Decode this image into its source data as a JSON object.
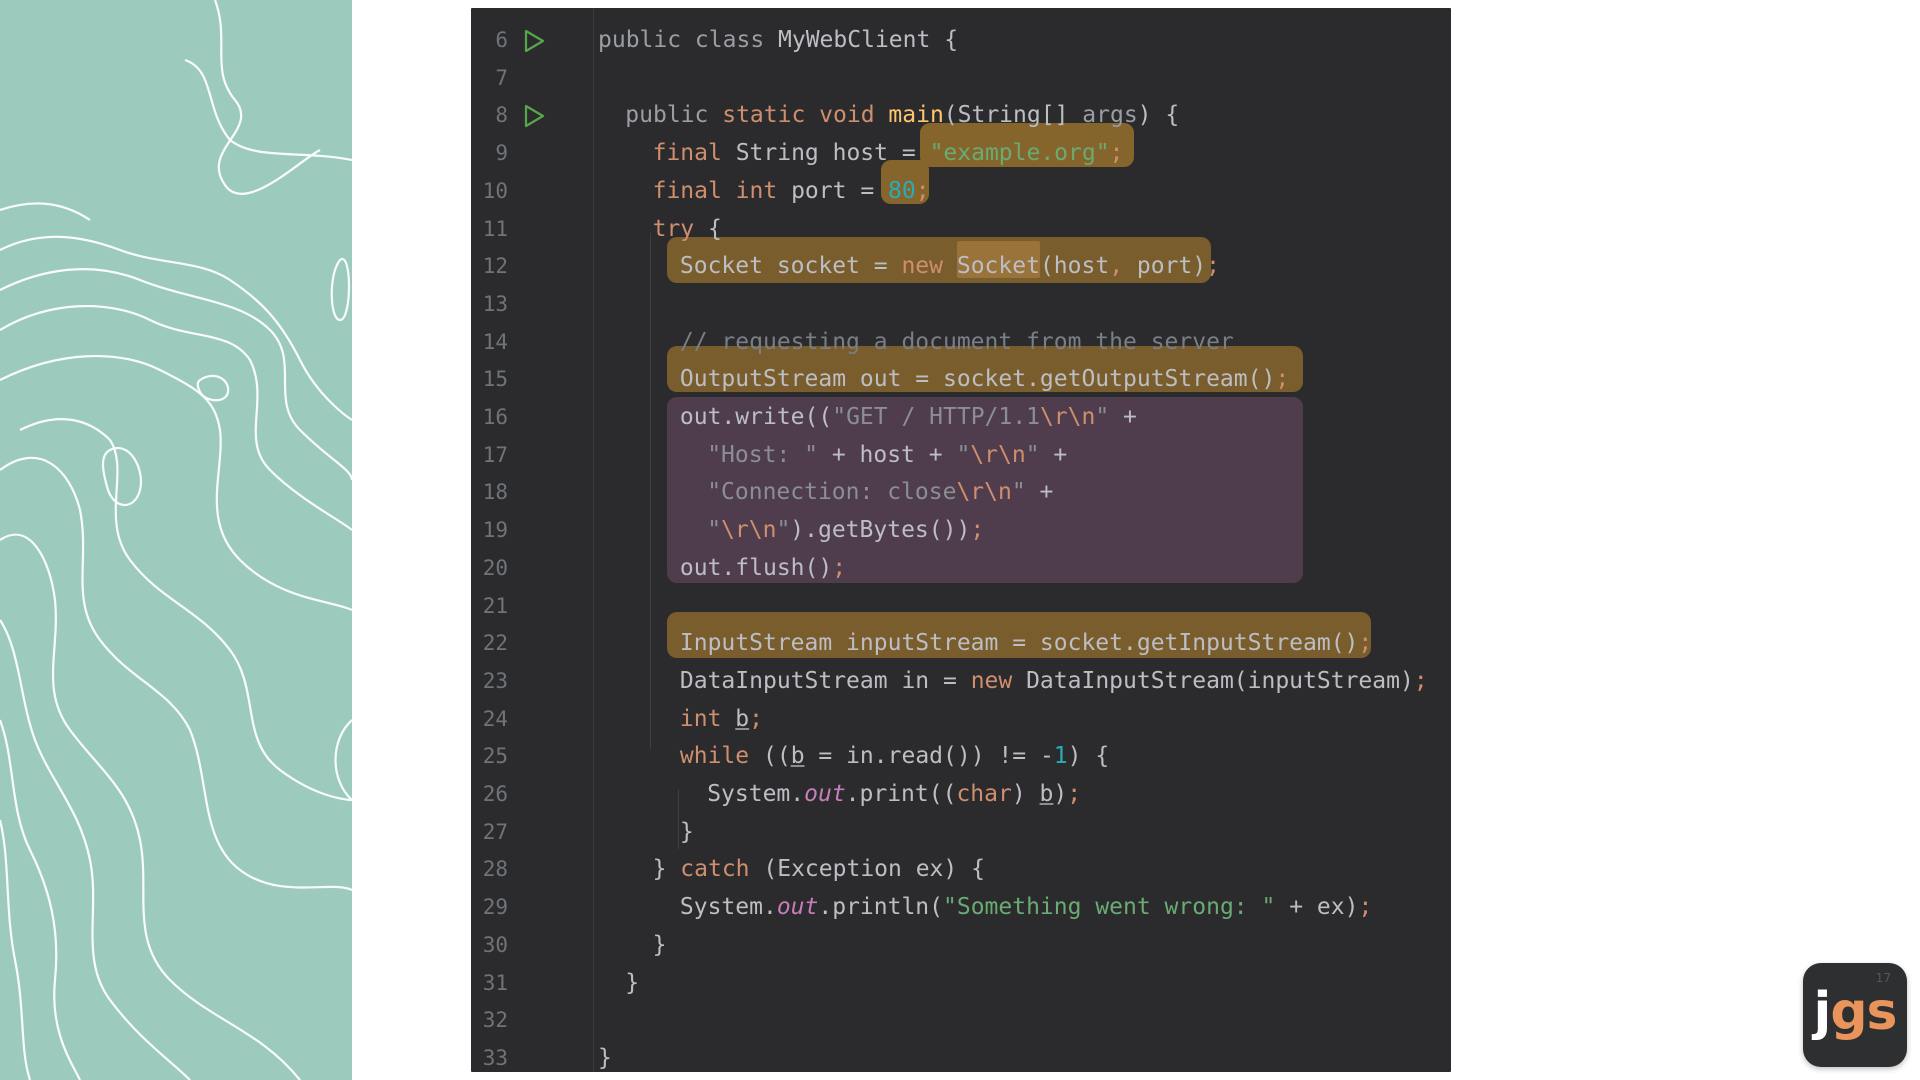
{
  "editor": {
    "lines": [
      {
        "n": "6",
        "run": true,
        "indent": 0,
        "tokens": [
          [
            "t-param",
            "public class "
          ],
          [
            "t-plain",
            "MyWebClient "
          ],
          [
            "t-plain",
            "{"
          ]
        ]
      },
      {
        "n": "7",
        "run": false,
        "indent": 0,
        "tokens": []
      },
      {
        "n": "8",
        "run": true,
        "indent": 1,
        "tokens": [
          [
            "t-param",
            "public "
          ],
          [
            "t-kw",
            "static void "
          ],
          [
            "t-fn-decl",
            "main"
          ],
          [
            "t-plain",
            "(String[] "
          ],
          [
            "t-param",
            "args"
          ],
          [
            "t-plain",
            ") {"
          ]
        ]
      },
      {
        "n": "9",
        "run": false,
        "indent": 2,
        "tokens": [
          [
            "t-kw",
            "final "
          ],
          [
            "t-plain",
            "String host = "
          ],
          [
            "t-str",
            "\"example.org\""
          ],
          [
            "t-semi",
            ";"
          ]
        ]
      },
      {
        "n": "10",
        "run": false,
        "indent": 2,
        "tokens": [
          [
            "t-kw",
            "final int "
          ],
          [
            "t-plain",
            "port = "
          ],
          [
            "t-num",
            "80"
          ],
          [
            "t-semi",
            ";"
          ]
        ]
      },
      {
        "n": "11",
        "run": false,
        "indent": 2,
        "tokens": [
          [
            "t-kw",
            "try "
          ],
          [
            "t-plain",
            "{"
          ]
        ]
      },
      {
        "n": "12",
        "run": false,
        "indent": 3,
        "tokens": [
          [
            "t-plain",
            "Socket socket = "
          ],
          [
            "t-kw",
            "new "
          ],
          [
            "t-plain",
            "Socket"
          ],
          [
            "t-plain",
            "(host"
          ],
          [
            "t-semi",
            ", "
          ],
          [
            "t-plain",
            "port)"
          ],
          [
            "t-semi",
            ";"
          ]
        ]
      },
      {
        "n": "13",
        "run": false,
        "indent": 3,
        "tokens": []
      },
      {
        "n": "14",
        "run": false,
        "indent": 3,
        "tokens": [
          [
            "t-cmt",
            "// requesting a document from the server"
          ]
        ]
      },
      {
        "n": "15",
        "run": false,
        "indent": 3,
        "tokens": [
          [
            "t-plain",
            "OutputStream out = socket.getOutputStream()"
          ],
          [
            "t-semi",
            ";"
          ]
        ]
      },
      {
        "n": "16",
        "run": false,
        "indent": 3,
        "tokens": [
          [
            "t-plain",
            "out.write(("
          ],
          [
            "t-dim",
            "\"GET / HTTP/1.1"
          ],
          [
            "t-esc",
            "\\r\\n"
          ],
          [
            "t-dim",
            "\" "
          ],
          [
            "t-plain",
            "+"
          ]
        ]
      },
      {
        "n": "17",
        "run": false,
        "indent": 4,
        "tokens": [
          [
            "t-dim",
            "\"Host: \" "
          ],
          [
            "t-plain",
            "+ host + "
          ],
          [
            "t-dim",
            "\""
          ],
          [
            "t-esc",
            "\\r\\n"
          ],
          [
            "t-dim",
            "\" "
          ],
          [
            "t-plain",
            "+"
          ]
        ]
      },
      {
        "n": "18",
        "run": false,
        "indent": 4,
        "tokens": [
          [
            "t-dim",
            "\"Connection: close"
          ],
          [
            "t-esc",
            "\\r\\n"
          ],
          [
            "t-dim",
            "\" "
          ],
          [
            "t-plain",
            "+"
          ]
        ]
      },
      {
        "n": "19",
        "run": false,
        "indent": 4,
        "tokens": [
          [
            "t-dim",
            "\""
          ],
          [
            "t-esc",
            "\\r\\n"
          ],
          [
            "t-dim",
            "\""
          ],
          [
            "t-plain",
            ").getBytes())"
          ],
          [
            "t-semi",
            ";"
          ]
        ]
      },
      {
        "n": "20",
        "run": false,
        "indent": 3,
        "tokens": [
          [
            "t-plain",
            "out.flush()"
          ],
          [
            "t-semi",
            ";"
          ]
        ]
      },
      {
        "n": "21",
        "run": false,
        "indent": 3,
        "tokens": []
      },
      {
        "n": "22",
        "run": false,
        "indent": 3,
        "tokens": [
          [
            "t-plain",
            "InputStream inputStream = socket.getInputStream()"
          ],
          [
            "t-semi",
            ";"
          ]
        ]
      },
      {
        "n": "23",
        "run": false,
        "indent": 3,
        "tokens": [
          [
            "t-plain",
            "DataInputStream in = "
          ],
          [
            "t-kw",
            "new "
          ],
          [
            "t-plain",
            "DataInputStream(inputStream)"
          ],
          [
            "t-semi",
            ";"
          ]
        ]
      },
      {
        "n": "24",
        "run": false,
        "indent": 3,
        "tokens": [
          [
            "t-kw",
            "int "
          ],
          [
            "t-var-u",
            "b"
          ],
          [
            "t-semi",
            ";"
          ]
        ]
      },
      {
        "n": "25",
        "run": false,
        "indent": 3,
        "tokens": [
          [
            "t-kw",
            "while "
          ],
          [
            "t-plain",
            "(("
          ],
          [
            "t-var-u",
            "b"
          ],
          [
            "t-plain",
            " = in.read()) != -"
          ],
          [
            "t-num",
            "1"
          ],
          [
            "t-plain",
            ") {"
          ]
        ]
      },
      {
        "n": "26",
        "run": false,
        "indent": 4,
        "tokens": [
          [
            "t-plain",
            "System."
          ],
          [
            "t-static",
            "out"
          ],
          [
            "t-plain",
            ".print(("
          ],
          [
            "t-kw",
            "char"
          ],
          [
            "t-plain",
            ") "
          ],
          [
            "t-var-u",
            "b"
          ],
          [
            "t-plain",
            ")"
          ],
          [
            "t-semi",
            ";"
          ]
        ]
      },
      {
        "n": "27",
        "run": false,
        "indent": 3,
        "tokens": [
          [
            "t-plain",
            "}"
          ]
        ]
      },
      {
        "n": "28",
        "run": false,
        "indent": 2,
        "tokens": [
          [
            "t-plain",
            "} "
          ],
          [
            "t-kw",
            "catch "
          ],
          [
            "t-plain",
            "(Exception ex) {"
          ]
        ]
      },
      {
        "n": "29",
        "run": false,
        "indent": 3,
        "tokens": [
          [
            "t-plain",
            "System."
          ],
          [
            "t-static",
            "out"
          ],
          [
            "t-plain",
            ".println("
          ],
          [
            "t-str",
            "\"Something went wrong: \" "
          ],
          [
            "t-plain",
            "+ ex)"
          ],
          [
            "t-semi",
            ";"
          ]
        ]
      },
      {
        "n": "30",
        "run": false,
        "indent": 2,
        "tokens": [
          [
            "t-plain",
            "}"
          ]
        ]
      },
      {
        "n": "31",
        "run": false,
        "indent": 1,
        "tokens": [
          [
            "t-plain",
            "}"
          ]
        ]
      },
      {
        "n": "32",
        "run": false,
        "indent": 0,
        "tokens": []
      },
      {
        "n": "33",
        "run": false,
        "indent": 0,
        "tokens": [
          [
            "t-plain",
            "}"
          ]
        ]
      }
    ]
  },
  "logo": {
    "j": "j",
    "gs": "gs"
  },
  "slide_number": "17",
  "colors": {
    "panel": "#9ccbbd",
    "editor_bg": "#2b2b2d",
    "highlight_gold": "#7a5d2c",
    "highlight_purple": "#4f3d4d",
    "logo_accent": "#e9945a"
  },
  "icons": {
    "run": "run-gutter-icon"
  }
}
